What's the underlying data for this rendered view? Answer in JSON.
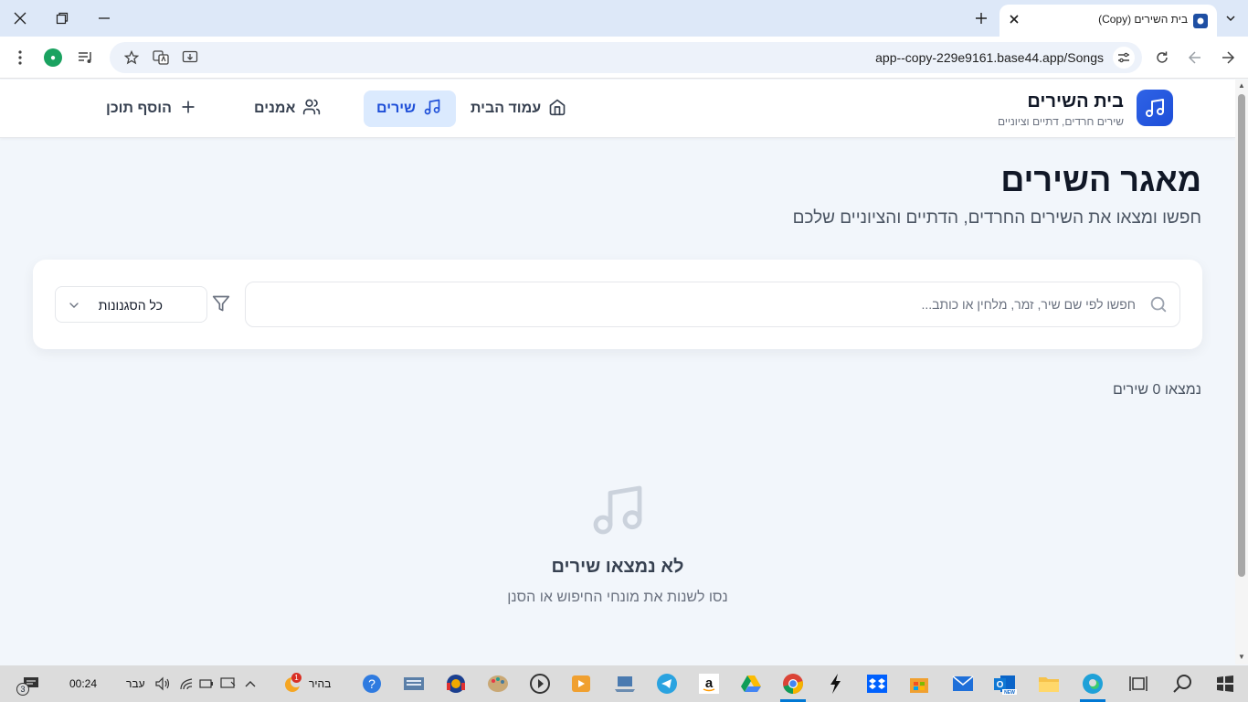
{
  "browser": {
    "tab_title": "בית השירים (Copy)",
    "url": "app--copy-229e9161.base44.app/Songs"
  },
  "header": {
    "brand_title": "בית השירים",
    "brand_subtitle": "שירים חרדים, דתיים וציוניים",
    "nav": {
      "home": "עמוד הבית",
      "songs": "שירים",
      "artists": "אמנים",
      "add_content": "הוסף תוכן"
    },
    "active_nav": "songs"
  },
  "main": {
    "title": "מאגר השירים",
    "subtitle": "חפשו ומצאו את השירים החרדים, הדתיים והציוניים שלכם",
    "search": {
      "placeholder": "חפשו לפי שם שיר, זמר, מלחין או כותב...",
      "value": ""
    },
    "genre_filter": {
      "selected": "כל הסגנונות"
    },
    "result_count": "נמצאו 0 שירים",
    "empty_state": {
      "title": "לא נמצאו שירים",
      "subtitle": "נסו לשנות את מונחי החיפוש או הסנן"
    }
  },
  "taskbar": {
    "clock": "00:24",
    "language": "עבר",
    "weather": "בהיר",
    "weather_badge": "1",
    "notification_count": "3"
  },
  "colors": {
    "accent": "#1d4ed8",
    "accent_light": "#dbeafe",
    "page_bg": "#f2f6fb",
    "chrome_bg": "#dde8f8"
  }
}
